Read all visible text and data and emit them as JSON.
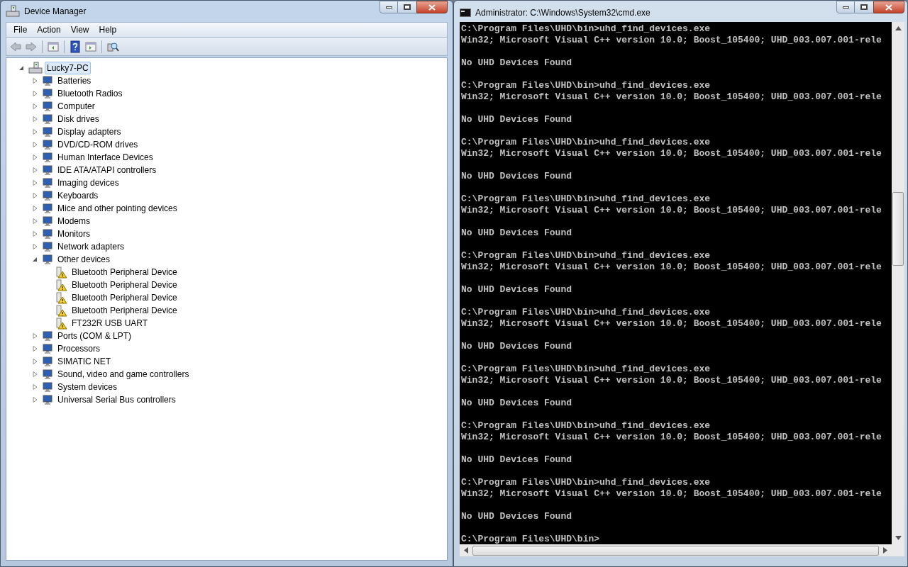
{
  "device_manager": {
    "title": "Device Manager",
    "menu": [
      "File",
      "Action",
      "View",
      "Help"
    ],
    "tree": {
      "label": "Lucky7-PC",
      "expanded": true,
      "selected": true,
      "children": [
        {
          "label": "Batteries",
          "expanded": false
        },
        {
          "label": "Bluetooth Radios",
          "expanded": false
        },
        {
          "label": "Computer",
          "expanded": false
        },
        {
          "label": "Disk drives",
          "expanded": false
        },
        {
          "label": "Display adapters",
          "expanded": false
        },
        {
          "label": "DVD/CD-ROM drives",
          "expanded": false
        },
        {
          "label": "Human Interface Devices",
          "expanded": false
        },
        {
          "label": "IDE ATA/ATAPI controllers",
          "expanded": false
        },
        {
          "label": "Imaging devices",
          "expanded": false
        },
        {
          "label": "Keyboards",
          "expanded": false
        },
        {
          "label": "Mice and other pointing devices",
          "expanded": false
        },
        {
          "label": "Modems",
          "expanded": false
        },
        {
          "label": "Monitors",
          "expanded": false
        },
        {
          "label": "Network adapters",
          "expanded": false
        },
        {
          "label": "Other devices",
          "expanded": true,
          "children": [
            {
              "label": "Bluetooth Peripheral Device",
              "warning": true
            },
            {
              "label": "Bluetooth Peripheral Device",
              "warning": true
            },
            {
              "label": "Bluetooth Peripheral Device",
              "warning": true
            },
            {
              "label": "Bluetooth Peripheral Device",
              "warning": true
            },
            {
              "label": "FT232R USB UART",
              "warning": true
            }
          ]
        },
        {
          "label": "Ports (COM & LPT)",
          "expanded": false
        },
        {
          "label": "Processors",
          "expanded": false
        },
        {
          "label": "SIMATIC NET",
          "expanded": false
        },
        {
          "label": "Sound, video and game controllers",
          "expanded": false
        },
        {
          "label": "System devices",
          "expanded": false
        },
        {
          "label": "Universal Serial Bus controllers",
          "expanded": false
        }
      ]
    }
  },
  "console": {
    "title": "Administrator: C:\\Windows\\System32\\cmd.exe",
    "blocks": [
      {
        "command": "C:\\Program Files\\UHD\\bin>uhd_find_devices.exe",
        "output": "Win32; Microsoft Visual C++ version 10.0; Boost_105400; UHD_003.007.001-rele",
        "result": "No UHD Devices Found"
      },
      {
        "command": "C:\\Program Files\\UHD\\bin>uhd_find_devices.exe",
        "output": "Win32; Microsoft Visual C++ version 10.0; Boost_105400; UHD_003.007.001-rele",
        "result": "No UHD Devices Found"
      },
      {
        "command": "C:\\Program Files\\UHD\\bin>uhd_find_devices.exe",
        "output": "Win32; Microsoft Visual C++ version 10.0; Boost_105400; UHD_003.007.001-rele",
        "result": "No UHD Devices Found"
      },
      {
        "command": "C:\\Program Files\\UHD\\bin>uhd_find_devices.exe",
        "output": "Win32; Microsoft Visual C++ version 10.0; Boost_105400; UHD_003.007.001-rele",
        "result": "No UHD Devices Found"
      },
      {
        "command": "C:\\Program Files\\UHD\\bin>uhd_find_devices.exe",
        "output": "Win32; Microsoft Visual C++ version 10.0; Boost_105400; UHD_003.007.001-rele",
        "result": "No UHD Devices Found"
      },
      {
        "command": "C:\\Program Files\\UHD\\bin>uhd_find_devices.exe",
        "output": "Win32; Microsoft Visual C++ version 10.0; Boost_105400; UHD_003.007.001-rele",
        "result": "No UHD Devices Found"
      },
      {
        "command": "C:\\Program Files\\UHD\\bin>uhd_find_devices.exe",
        "output": "Win32; Microsoft Visual C++ version 10.0; Boost_105400; UHD_003.007.001-rele",
        "result": "No UHD Devices Found"
      },
      {
        "command": "C:\\Program Files\\UHD\\bin>uhd_find_devices.exe",
        "output": "Win32; Microsoft Visual C++ version 10.0; Boost_105400; UHD_003.007.001-rele",
        "result": "No UHD Devices Found"
      },
      {
        "command": "C:\\Program Files\\UHD\\bin>uhd_find_devices.exe",
        "output": "Win32; Microsoft Visual C++ version 10.0; Boost_105400; UHD_003.007.001-rele",
        "result": "No UHD Devices Found"
      }
    ],
    "prompt": "C:\\Program Files\\UHD\\bin>"
  }
}
